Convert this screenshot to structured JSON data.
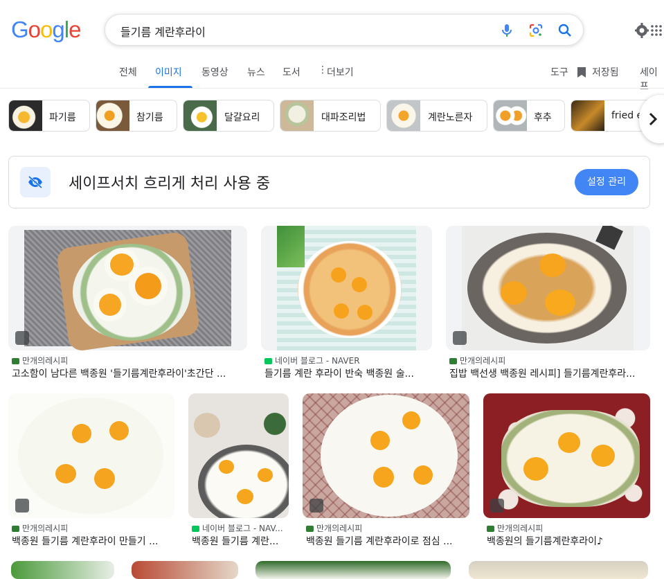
{
  "search": {
    "query": "들기름 계란후라이"
  },
  "logo": "Google",
  "tabs": [
    {
      "label": "전체"
    },
    {
      "label": "이미지"
    },
    {
      "label": "동영상"
    },
    {
      "label": "뉴스"
    },
    {
      "label": "도서"
    },
    {
      "label": "더보기"
    }
  ],
  "tools": {
    "tools_label": "도구",
    "saved_label": "저장됨",
    "safe_label": "세이프"
  },
  "chips": [
    {
      "label": "파기름"
    },
    {
      "label": "참기름"
    },
    {
      "label": "달걀요리"
    },
    {
      "label": "대파조리법"
    },
    {
      "label": "계란노른자"
    },
    {
      "label": "후추"
    },
    {
      "label": "fried e"
    }
  ],
  "safesearch": {
    "message": "세이프서치 흐리게 처리 사용 중",
    "button": "설정 관리"
  },
  "results": [
    {
      "source": "만개의레시피",
      "title": "고소함이 남다른 백종원 '들기름계란후라이'초간단 ..."
    },
    {
      "source": "네이버 블로그 - NAVER",
      "title": "들기름 계란 후라이 반숙 백종원 술..."
    },
    {
      "source": "만개의레시피",
      "title": "집밥 백선생 백종원 레시피] 들기름계란후라..."
    },
    {
      "source": "만개의레시피",
      "title": "백종원 들기름 계란후라이 만들기 ..."
    },
    {
      "source": "네이버 블로그 - NAV...",
      "title": "백종원 들기름 계란..."
    },
    {
      "source": "만개의레시피",
      "title": "백종원 들기름 계란후라이로 점심 ..."
    },
    {
      "source": "만개의레시피",
      "title": "백종원의 들기름계란후라이♪"
    }
  ],
  "colors": {
    "accent": "#1a73e8",
    "button": "#4285f4",
    "recipe_favicon": "#2e7d32",
    "naver_favicon": "#03c75a"
  }
}
